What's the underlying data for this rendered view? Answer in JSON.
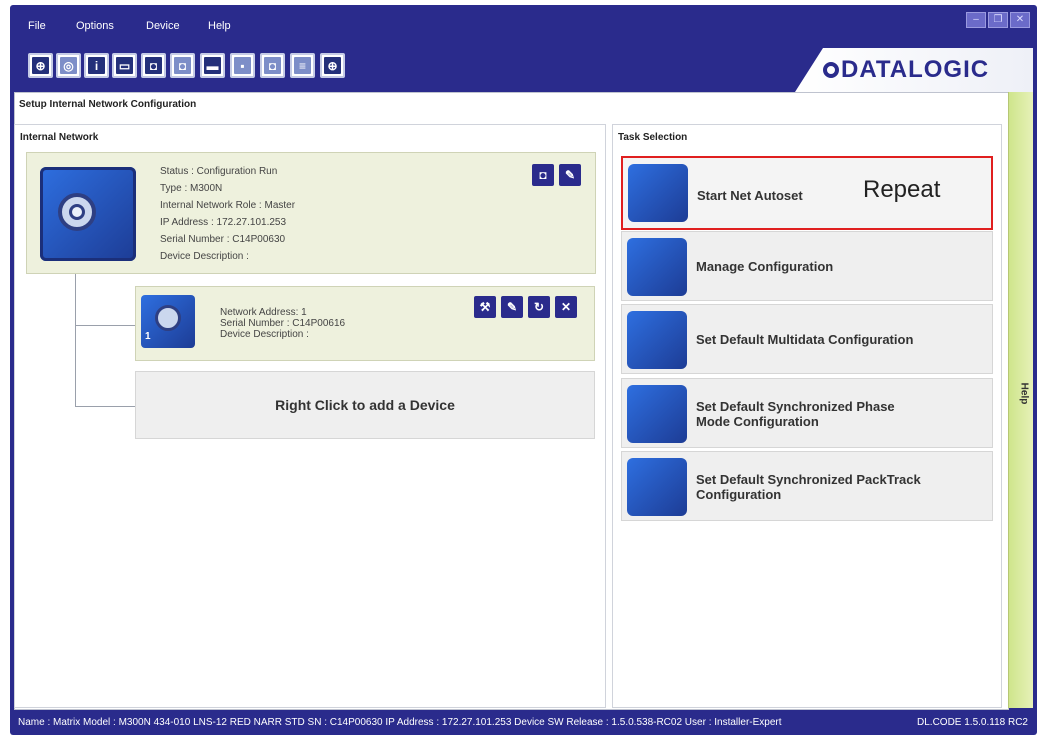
{
  "menu": {
    "file": "File",
    "options": "Options",
    "device": "Device",
    "help": "Help"
  },
  "brand": {
    "logo": "DATALOGIC",
    "color": "#2a2b8c"
  },
  "toolbar": {
    "icons": [
      "settings-icon",
      "autoset-icon",
      "user-icon",
      "window-icon",
      "device-monitor-icon",
      "device-scan-icon",
      "terminal-icon",
      "image-icon",
      "device-config-icon",
      "device-list-icon",
      "target-icon"
    ]
  },
  "page": {
    "title": "Setup Internal Network Configuration"
  },
  "left_panel": {
    "title": "Internal Network",
    "master": {
      "status": "Status : Configuration Run",
      "type": "Type : M300N",
      "role": "Internal Network Role : Master",
      "ip": "IP Address : 172.27.101.253",
      "serial": "Serial Number : C14P00630",
      "description": "Device Description :"
    },
    "slave": {
      "badge": "1",
      "address": "Network Address: 1",
      "serial": "Serial Number : C14P00616",
      "description": "Device Description :"
    },
    "add_device": "Right Click to add a Device"
  },
  "right_panel": {
    "title": "Task Selection",
    "tasks": [
      {
        "label": "Start Net Autoset",
        "icon": "autoset-icon"
      },
      {
        "label": "Manage Configuration",
        "icon": "documents-icon"
      },
      {
        "label": "Set Default Multidata Configuration",
        "icon": "multidata-icon"
      },
      {
        "label_line1": "Set Default Synchronized Phase",
        "label_line2": "Mode Configuration",
        "icon": "sync-phase-icon"
      },
      {
        "label_line1": "Set Default Synchronized PackTrack",
        "label_line2": "Configuration",
        "icon": "packtrack-icon"
      }
    ],
    "annotation": "Repeat"
  },
  "help_tab": "Help",
  "status": {
    "text": "Name : Matrix  Model : M300N 434-010 LNS-12 RED NARR STD  SN : C14P00630  IP Address : 172.27.101.253  Device SW Release : 1.5.0.538-RC02  User : Installer-Expert",
    "version": "DL.CODE 1.5.0.118 RC2"
  }
}
